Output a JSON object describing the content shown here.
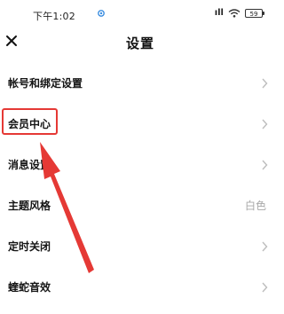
{
  "status_bar": {
    "time": "下午1:02",
    "signal": "ıll",
    "battery": "59"
  },
  "header": {
    "title": "设置"
  },
  "menu": {
    "items": [
      {
        "label": "帐号和绑定设置",
        "value": ""
      },
      {
        "label": "会员中心",
        "value": ""
      },
      {
        "label": "消息设置",
        "value": ""
      },
      {
        "label": "主题风格",
        "value": "白色"
      },
      {
        "label": "定时关闭",
        "value": ""
      },
      {
        "label": "蝰蛇音效",
        "value": ""
      }
    ]
  },
  "annotation": {
    "color": "#e53935"
  }
}
